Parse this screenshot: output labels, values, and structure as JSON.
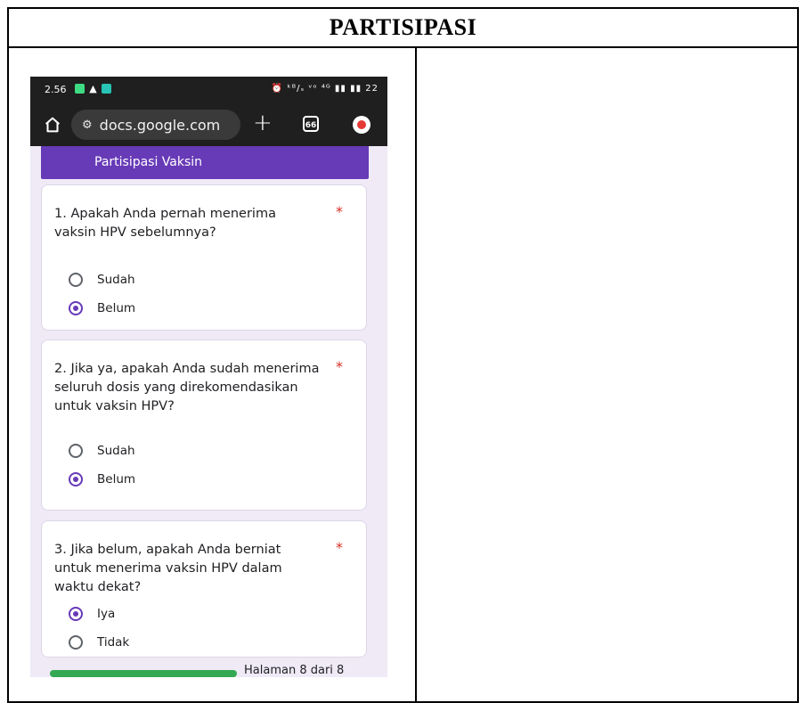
{
  "document": {
    "heading": "PARTISIPASI"
  },
  "status_bar": {
    "time": "2.56",
    "right_text": "⏰ ᵏᴮ/ₛ ᵛᵒ ⁴ᴳ ▮▮ ▮▮ 22"
  },
  "browser": {
    "url": "docs.google.com",
    "url_icon": "site-settings-icon",
    "tab_count": "66"
  },
  "form": {
    "section_title": "Partisipasi Vaksin",
    "required_marker": "*",
    "questions": [
      {
        "text": "1.  Apakah Anda pernah menerima vaksin HPV sebelumnya?",
        "options": [
          {
            "label": "Sudah",
            "selected": false
          },
          {
            "label": "Belum",
            "selected": true
          }
        ]
      },
      {
        "text": "2.  Jika ya, apakah Anda sudah menerima seluruh dosis yang direkomendasikan untuk vaksin HPV?",
        "options": [
          {
            "label": "Sudah",
            "selected": false
          },
          {
            "label": "Belum",
            "selected": true
          }
        ]
      },
      {
        "text": "3.  Jika belum, apakah Anda berniat untuk menerima vaksin HPV dalam waktu dekat?",
        "options": [
          {
            "label": "Iya",
            "selected": true
          },
          {
            "label": "Tidak",
            "selected": false
          }
        ]
      }
    ],
    "progress": {
      "label": "Halaman 8 dari 8",
      "fraction": 1.0
    }
  },
  "colors": {
    "accent": "#673ab7",
    "progress": "#34a853",
    "required": "#d93025"
  }
}
